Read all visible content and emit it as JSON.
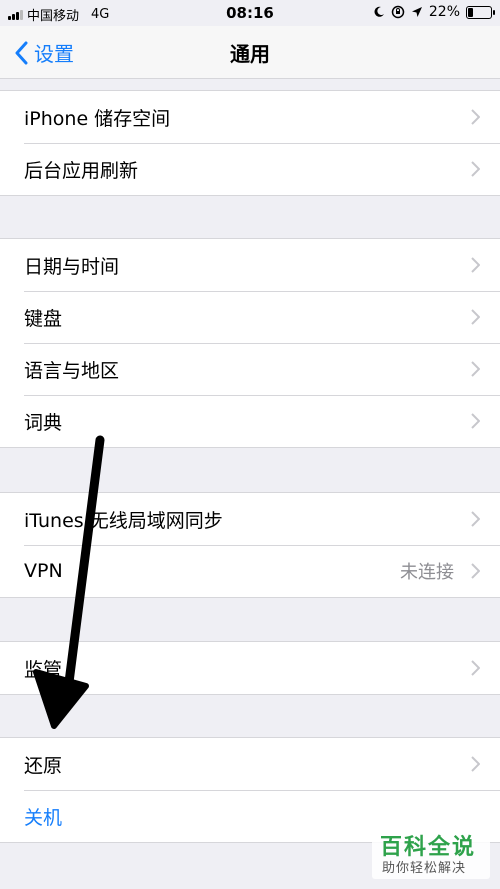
{
  "status_bar": {
    "carrier": "中国移动",
    "network": "4G",
    "time": "08:16",
    "battery": "22%"
  },
  "nav": {
    "back_label": "设置",
    "title": "通用"
  },
  "groups": [
    {
      "items": [
        {
          "label": "iPhone 储存空间"
        },
        {
          "label": "后台应用刷新"
        }
      ]
    },
    {
      "items": [
        {
          "label": "日期与时间"
        },
        {
          "label": "键盘"
        },
        {
          "label": "语言与地区"
        },
        {
          "label": "词典"
        }
      ]
    },
    {
      "items": [
        {
          "label": "iTunes 无线局域网同步"
        },
        {
          "label": "VPN",
          "detail": "未连接"
        }
      ]
    },
    {
      "items": [
        {
          "label": "监管"
        }
      ]
    },
    {
      "items": [
        {
          "label": "还原"
        },
        {
          "label": "关机"
        }
      ]
    }
  ],
  "watermark": {
    "main": "百科全说",
    "sub": "助你轻松解决"
  },
  "colors": {
    "accent": "#157efb",
    "background": "#efeff4",
    "separator": "#d6d6da"
  }
}
